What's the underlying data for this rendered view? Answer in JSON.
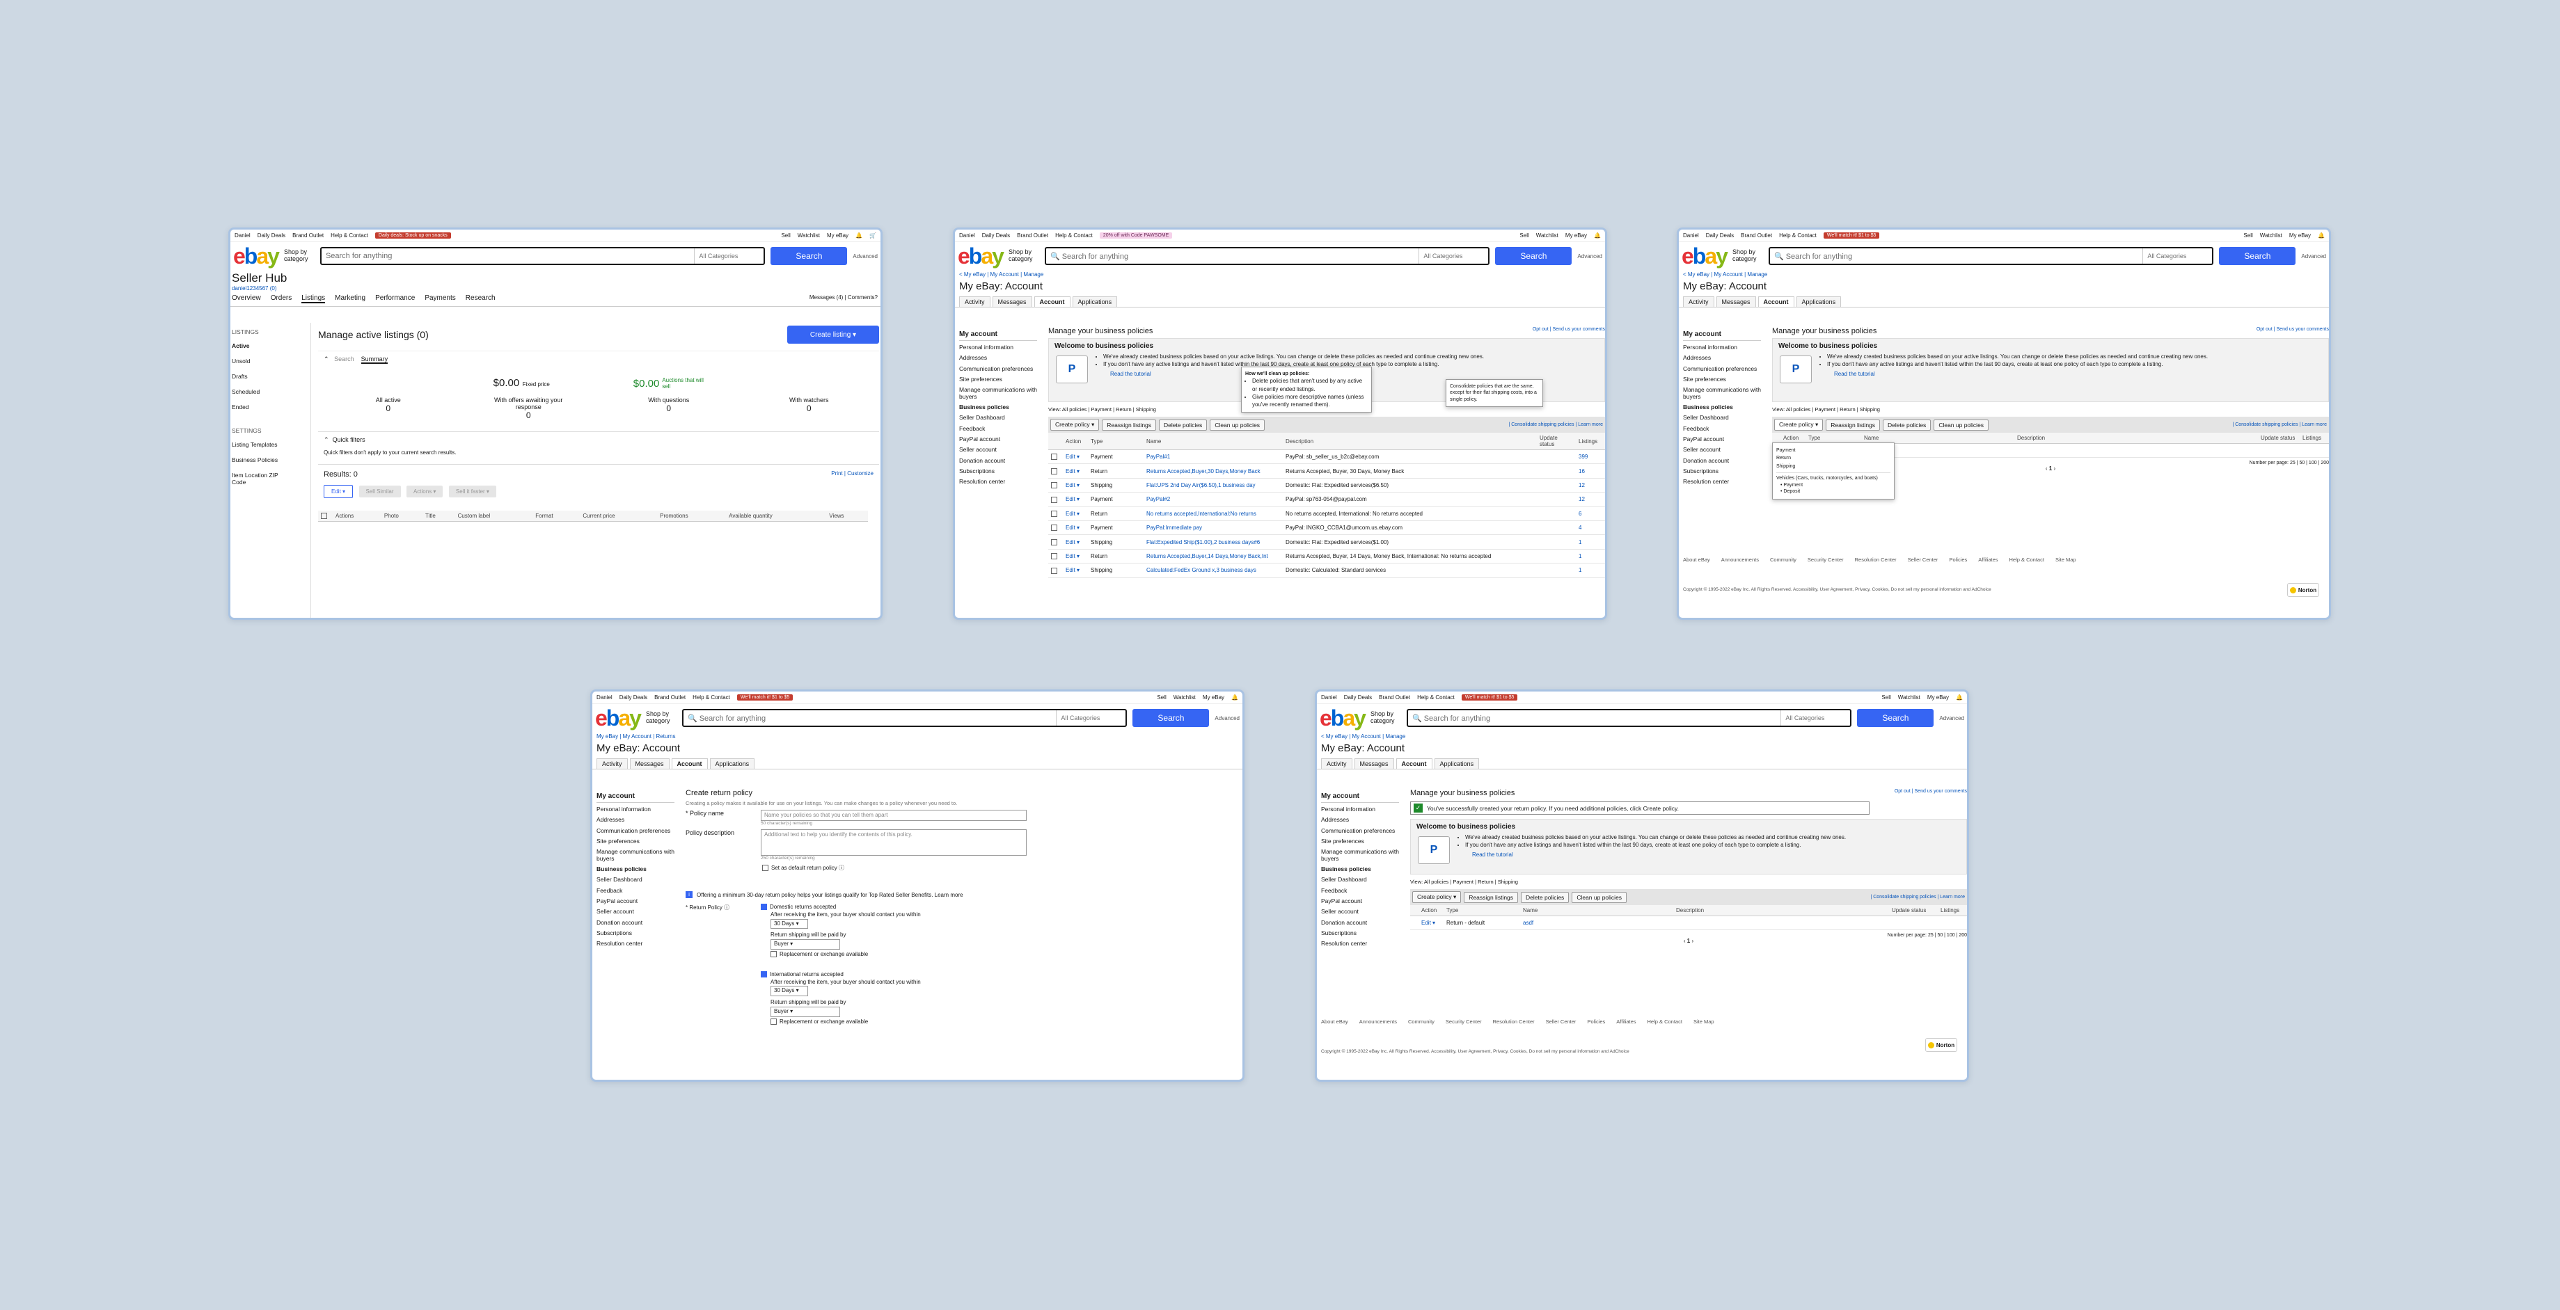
{
  "common": {
    "topbar": {
      "user": "Daniel",
      "daily_deals": "Daily Deals",
      "brand_outlet": "Brand Outlet",
      "help": "Help & Contact",
      "sell": "Sell",
      "watchlist": "Watchlist",
      "my_ebay": "My eBay"
    },
    "logo": [
      "e",
      "b",
      "a",
      "y"
    ],
    "shop_by": "Shop by category",
    "search_placeholder": "Search for anything",
    "all_categories": "All Categories",
    "search_button": "Search",
    "advanced": "Advanced",
    "account_title": "My eBay: Account",
    "tabs": [
      "Activity",
      "Messages",
      "Account",
      "Applications"
    ],
    "side": {
      "header": "My account",
      "items": [
        "Personal information",
        "Addresses",
        "Communication preferences",
        "Site preferences",
        "Manage communications with buyers",
        "Business policies",
        "Seller Dashboard",
        "Feedback",
        "PayPal account",
        "Seller account",
        "Donation account",
        "Subscriptions",
        "Resolution center"
      ]
    },
    "welcome_title": "Welcome to business policies",
    "welcome_lines": [
      "We've already created business policies based on your active listings. You can change or delete these policies as needed and continue creating new ones.",
      "If you don't have any active listings and haven't listed within the last 90 days, create at least one policy of each type to complete a listing."
    ],
    "read_tutorial": "Read the tutorial",
    "view_filters": "View: All policies | Payment | Return | Shipping",
    "toolbar": [
      "Create policy",
      "Reassign listings",
      "Delete policies",
      "Clean up policies"
    ],
    "consolidate": "| Consolidate shipping policies | Learn more",
    "cols": [
      "Action",
      "Type",
      "Name",
      "Description",
      "Update status",
      "Listings"
    ],
    "edit": "Edit",
    "manage_title": "Manage your business policies",
    "opt_out": "Opt out | Send us your comments",
    "per_page": "Number per page: 25 | 50 | 100 | 200",
    "page": "1",
    "footer_links": [
      "About eBay",
      "Announcements",
      "Community",
      "Security Center",
      "Resolution Center",
      "Seller Center",
      "Policies",
      "Affiliates",
      "Help & Contact",
      "Site Map"
    ],
    "copyright": "Copyright © 1995-2022 eBay Inc. All Rights Reserved. Accessibility, User Agreement, Privacy, Cookies, Do not sell my personal information and AdChoice",
    "norton": "Norton"
  },
  "p1": {
    "promo": "Daily deals: Stock up on snacks",
    "title": "Seller Hub",
    "user": "daniel1234567 (0)",
    "nav": [
      "Overview",
      "Orders",
      "Listings",
      "Marketing",
      "Performance",
      "Payments",
      "Research"
    ],
    "messages": "Messages (4)",
    "comments": "Comments?",
    "left_head": "LISTINGS",
    "left": [
      "Active",
      "Unsold",
      "Drafts",
      "Scheduled",
      "Ended"
    ],
    "left_head2": "SETTINGS",
    "left2": [
      "Listing Templates",
      "Business Policies",
      "Item Location ZIP Code"
    ],
    "heading": "Manage active listings (0)",
    "create": "Create listing",
    "search_tab": "Search",
    "summary_tab": "Summary",
    "fixed_amt": "$0.00",
    "fixed_lbl": "Fixed price",
    "auct_amt": "$0.00",
    "auct_lbl": "Auctions that will sell",
    "stats": [
      {
        "label": "All active",
        "v": "0"
      },
      {
        "label": "With offers awaiting your response",
        "v": "0"
      },
      {
        "label": "With questions",
        "v": "0"
      },
      {
        "label": "With watchers",
        "v": "0"
      }
    ],
    "quick": "Quick filters",
    "quick_note": "Quick filters don't apply to your current search results.",
    "results": "Results: 0",
    "print": "Print | Customize",
    "btns": [
      "Edit",
      "Sell Similar",
      "Actions",
      "Sell it faster"
    ],
    "cols": [
      "Actions",
      "Photo",
      "Title",
      "Custom label",
      "Format",
      "Current price",
      "Promotions",
      "Available quantity",
      "Views"
    ]
  },
  "p2": {
    "promo": "20% off with Code PAWSOME",
    "popup_title": "How we'll clean up policies:",
    "popup_lines": [
      "Delete policies that aren't used by any active or recently ended listings.",
      "Give policies more descriptive names (unless you've recently renamed them)."
    ],
    "popup2": "Consolidate policies that are the same, except for their flat shipping costs, into a single policy.",
    "rows": [
      {
        "type": "Payment",
        "name": "PayPal#1",
        "desc": "PayPal: sb_seller_us_b2c@ebay.com",
        "n": "399"
      },
      {
        "type": "Return",
        "name": "Returns Accepted,Buyer,30 Days,Money Back",
        "desc": "Returns Accepted, Buyer, 30 Days, Money Back",
        "n": "16"
      },
      {
        "type": "Shipping",
        "name": "Flat:UPS 2nd Day Air($6.50),1 business day",
        "desc": "Domestic: Flat: Expedited services($6.50)",
        "n": "12"
      },
      {
        "type": "Payment",
        "name": "PayPal#2",
        "desc": "PayPal: sp763-054@paypal.com",
        "n": "12"
      },
      {
        "type": "Return",
        "name": "No returns accepted,International:No returns",
        "desc": "No returns accepted, International: No returns accepted",
        "n": "6"
      },
      {
        "type": "Payment",
        "name": "PayPal:Immediate pay",
        "desc": "PayPal: INGKO_CCBA1@umcom.us.ebay.com",
        "n": "4"
      },
      {
        "type": "Shipping",
        "name": "Flat:Expedited Ship($1.00),2 business days#6",
        "desc": "Domestic: Flat: Expedited services($1.00)",
        "n": "1"
      },
      {
        "type": "Return",
        "name": "Returns Accepted,Buyer,14 Days,Money Back,Int",
        "desc": "Returns Accepted, Buyer, 14 Days, Money Back, International: No returns accepted",
        "n": "1"
      },
      {
        "type": "Shipping",
        "name": "Calculated:FedEx Ground x,3 business days",
        "desc": "Domestic: Calculated: Standard services",
        "n": "1"
      }
    ]
  },
  "p3": {
    "promo": "We'll match it! $1 to $5",
    "menu": [
      "Payment",
      "Return",
      "Shipping"
    ],
    "menu_note": "Vehicles (Cars, trucks, motorcycles, and boats)",
    "menu_sub": [
      "Payment",
      "Deposit"
    ],
    "row": {
      "type": "Return - default",
      "name": "asdf"
    }
  },
  "p4": {
    "promo": "We'll match it! $1 to $5",
    "bc": "My eBay | My Account | Returns",
    "heading": "Create return policy",
    "intro": "Creating a policy makes it available for use on your listings. You can make changes to a policy whenever you need to.",
    "name_lbl": "Policy name",
    "name_ph": "Name your policies so that you can tell them apart",
    "name_rem": "50 character(s) remaining",
    "desc_lbl": "Policy description",
    "desc_ph": "Additional text to help you identify the contents of this policy.",
    "desc_rem": "250 character(s) remaining",
    "default": "Set as default return policy",
    "banner": "Offering a minimum 30-day return policy helps your listings qualify for Top Rated Seller Benefits. Learn more",
    "rp_lbl": "Return Policy",
    "dom": "Domestic returns accepted",
    "after": "After receiving the item, your buyer should contact you within",
    "days": "30 Days",
    "paid": "Return shipping will be paid by",
    "buyer": "Buyer",
    "replace": "Replacement or exchange available",
    "intl": "International returns accepted"
  },
  "p5": {
    "promo": "We'll match it! $1 to $5",
    "success": "You've successfully created your return policy. If you need additional policies, click Create policy.",
    "row": {
      "type": "Return - default",
      "name": "asdf"
    }
  }
}
